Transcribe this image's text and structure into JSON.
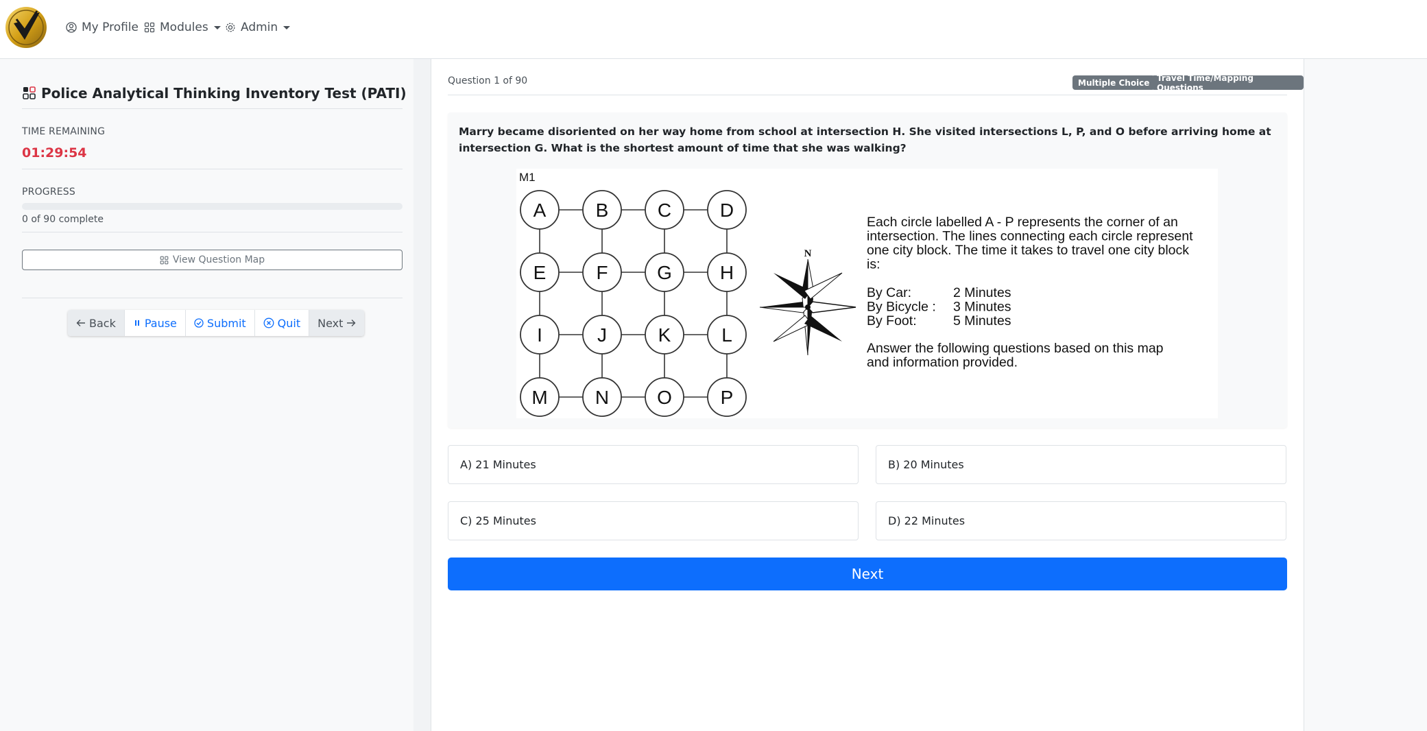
{
  "navbar": {
    "my_profile": "My Profile",
    "modules": "Modules",
    "admin": "Admin"
  },
  "sidebar": {
    "title": "Police Analytical Thinking Inventory Test (PATI)",
    "time_label": "TIME REMAINING",
    "time_value": "01:29:54",
    "progress_label": "PROGRESS",
    "progress_text": "0 of 90 complete",
    "progress_percent": 0,
    "view_map": "View Question Map",
    "buttons": {
      "back": "Back",
      "pause": "Pause",
      "submit": "Submit",
      "quit": "Quit",
      "next": "Next"
    }
  },
  "question": {
    "counter": "Question 1 of 90",
    "badges": [
      "Multiple Choice",
      "Travel Time/Mapping Questions"
    ],
    "text": "Marry became disoriented on her way home from school at intersection H. She visited intersections L, P, and O before arriving home at intersection G. What is the shortest amount of time that she was walking?",
    "figure": {
      "map_label": "M1",
      "nodes": [
        "A",
        "B",
        "C",
        "D",
        "E",
        "F",
        "G",
        "H",
        "I",
        "J",
        "K",
        "L",
        "M",
        "N",
        "O",
        "P"
      ],
      "compass_label": "N",
      "description_lines": [
        "Each circle labelled A - P represents the corner of an",
        "intersection. The lines connecting each circle represent",
        "one city block. The time it takes to travel one city block",
        "is:"
      ],
      "rates": [
        {
          "mode": "By Car:",
          "time": "2 Minutes"
        },
        {
          "mode": "By Bicycle :",
          "time": "3 Minutes"
        },
        {
          "mode": "By Foot:",
          "time": "5 Minutes"
        }
      ],
      "footer_lines": [
        "Answer the following questions based on this map",
        "and information provided."
      ]
    },
    "answers": [
      "A) 21 Minutes",
      "B) 20 Minutes",
      "C) 25 Minutes",
      "D) 22 Minutes"
    ],
    "next_label": "Next"
  }
}
